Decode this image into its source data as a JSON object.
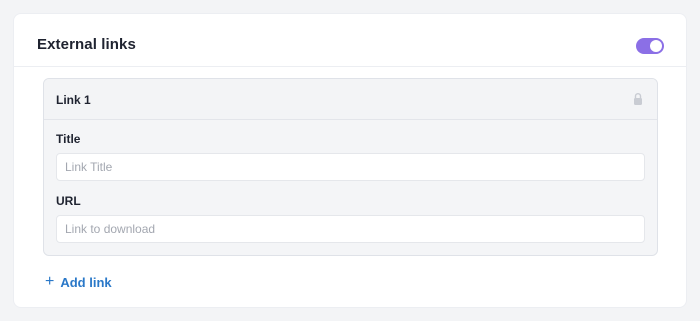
{
  "section": {
    "title": "External links",
    "toggle_on": true,
    "accent_color": "#8b6fe6"
  },
  "links": [
    {
      "header": "Link 1",
      "title_label": "Title",
      "title_placeholder": "Link Title",
      "title_value": "",
      "url_label": "URL",
      "url_placeholder": "Link to download",
      "url_value": "",
      "header_icon": "lock-icon"
    }
  ],
  "add_link": {
    "label": "Add link",
    "icon": "plus-icon",
    "color": "#2a78c8"
  }
}
